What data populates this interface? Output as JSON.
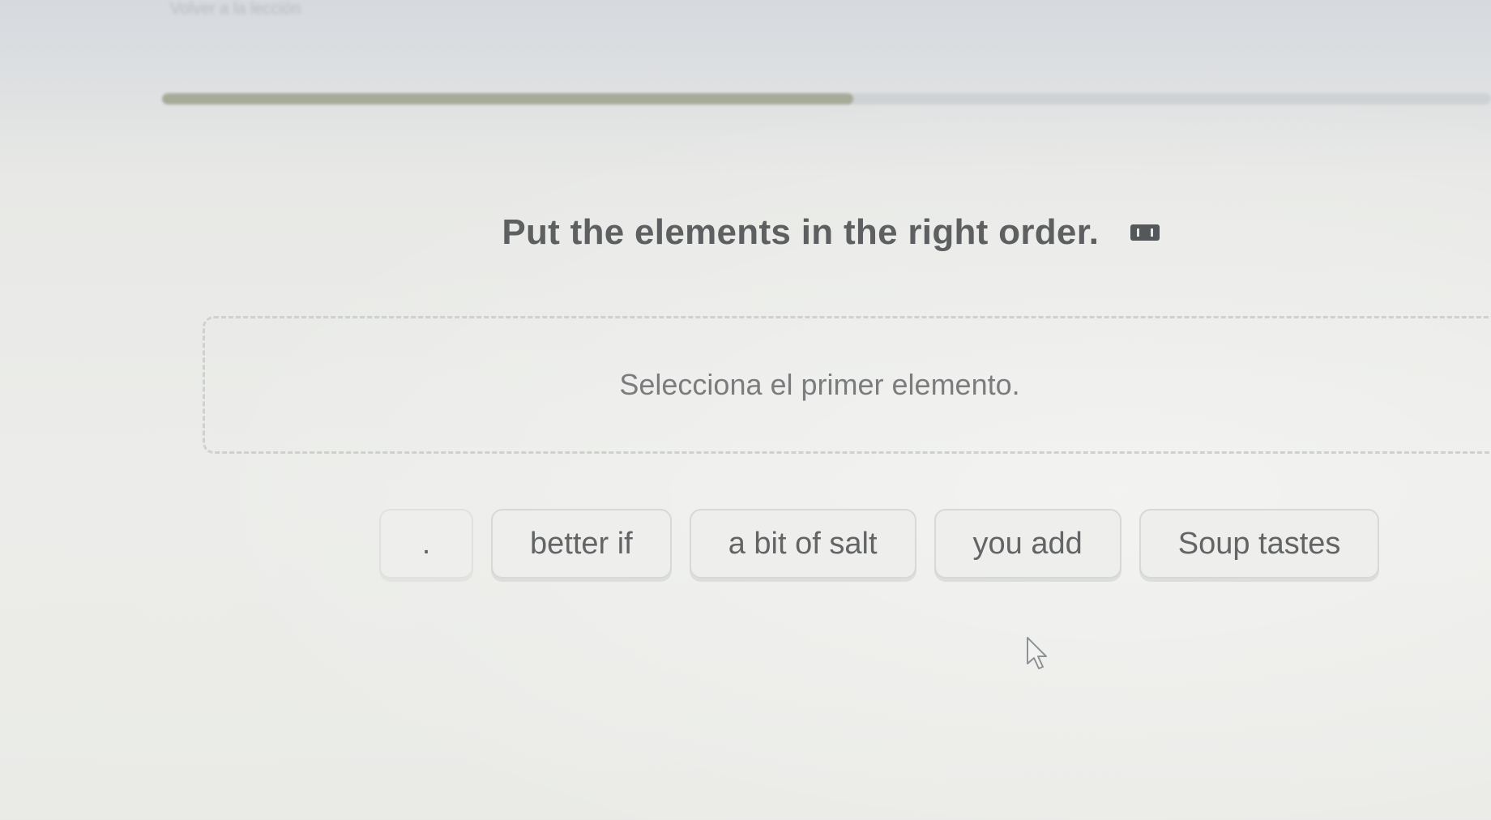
{
  "header": {
    "top_label": "Volver a la lección",
    "progress": 0.52
  },
  "exercise": {
    "prompt": "Put the elements in the right order.",
    "translate_icon": "translate-icon",
    "answer_placeholder": "Selecciona el primer elemento.",
    "tokens": [
      {
        "label": "."
      },
      {
        "label": "better if"
      },
      {
        "label": "a bit of salt"
      },
      {
        "label": "you add"
      },
      {
        "label": "Soup tastes"
      }
    ]
  },
  "cursor": {
    "icon": "mouse-pointer-icon"
  },
  "colors": {
    "progress_fill": "#a6ab98",
    "progress_track": "#cfd2d4",
    "text": "#5d5f61"
  }
}
